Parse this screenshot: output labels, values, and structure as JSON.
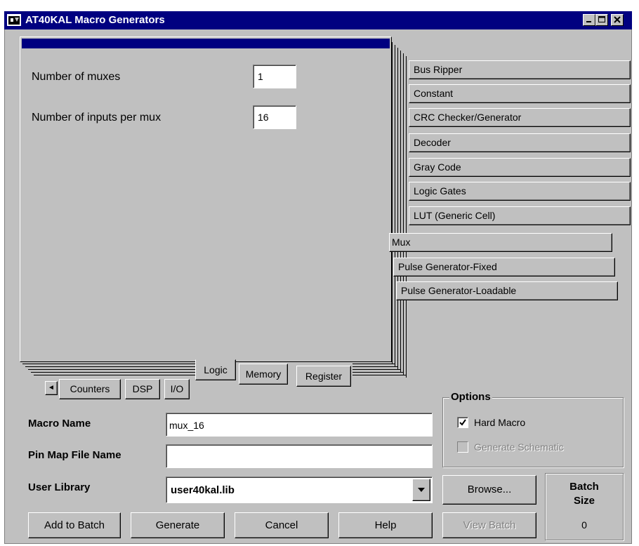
{
  "window": {
    "title": "AT40KAL Macro Generators",
    "minimize": "_",
    "maximize": "□",
    "close": "×"
  },
  "panel": {
    "fields": [
      {
        "label": "Number of muxes",
        "value": "1"
      },
      {
        "label": "Number of inputs per mux",
        "value": "16"
      }
    ]
  },
  "side_tabs": [
    "Bus Ripper",
    "Constant",
    "CRC Checker/Generator",
    "Decoder",
    "Gray Code",
    "Logic Gates",
    "LUT (Generic Cell)",
    "Mux",
    "Pulse Generator-Fixed",
    "Pulse Generator-Loadable"
  ],
  "bottom_tabs": {
    "row1": [
      "Logic",
      "Memory",
      "Register"
    ],
    "row2": [
      "Counters",
      "DSP",
      "I/O"
    ],
    "scroll_left": "◄"
  },
  "form": {
    "macro_name_label": "Macro Name",
    "macro_name_value": "mux_16",
    "pin_map_label": "Pin Map File Name",
    "pin_map_value": "",
    "user_library_label": "User Library",
    "user_library_value": "user40kal.lib"
  },
  "options": {
    "title": "Options",
    "hard_macro_label": "Hard Macro",
    "hard_macro_checked": true,
    "generate_schematic_label": "Generate Schematic",
    "generate_schematic_checked": false
  },
  "buttons": {
    "browse": "Browse...",
    "view_batch": "View Batch",
    "add_to_batch": "Add to Batch",
    "generate": "Generate",
    "cancel": "Cancel",
    "help": "Help"
  },
  "batch": {
    "label_line1": "Batch",
    "label_line2": "Size",
    "value": "0"
  }
}
